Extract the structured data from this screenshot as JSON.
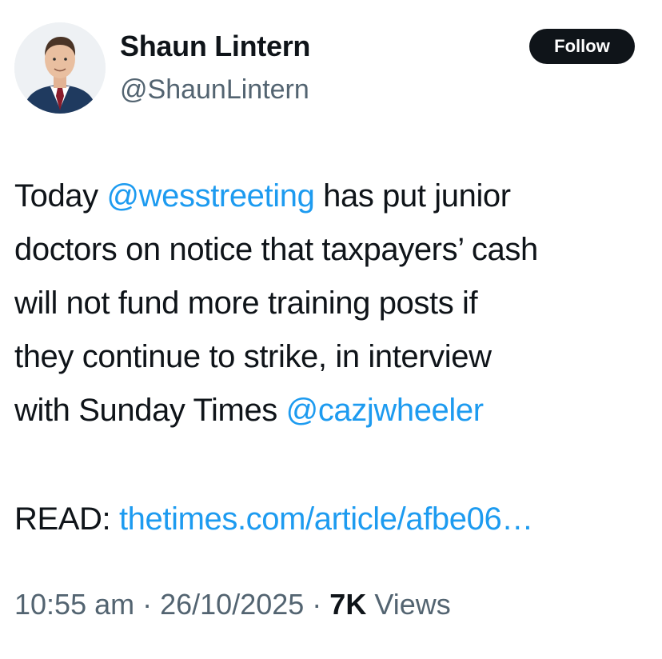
{
  "author": {
    "display_name": "Shaun Lintern",
    "handle": "@ShaunLintern"
  },
  "follow_button": {
    "label": "Follow"
  },
  "tweet": {
    "line1": {
      "pre": "Today ",
      "mention": "@wesstreeting",
      "post": " has put junior"
    },
    "line2": "doctors on notice that taxpayers’ cash",
    "line3": "will not fund more training posts if",
    "line4": "they continue to strike, in interview",
    "line5": {
      "pre": "with Sunday Times ",
      "mention": "@cazjwheeler"
    },
    "read": {
      "label": "READ: ",
      "link": "thetimes.com/article/afbe06…"
    }
  },
  "meta": {
    "time": "10:55 am",
    "sep1": " · ",
    "date": "26/10/2025",
    "sep2": " · ",
    "views_count": "7K",
    "views_label": " Views"
  },
  "colors": {
    "link": "#1d9bf0",
    "text": "#0f1419",
    "muted": "#536471",
    "button_bg": "#0f1419"
  }
}
